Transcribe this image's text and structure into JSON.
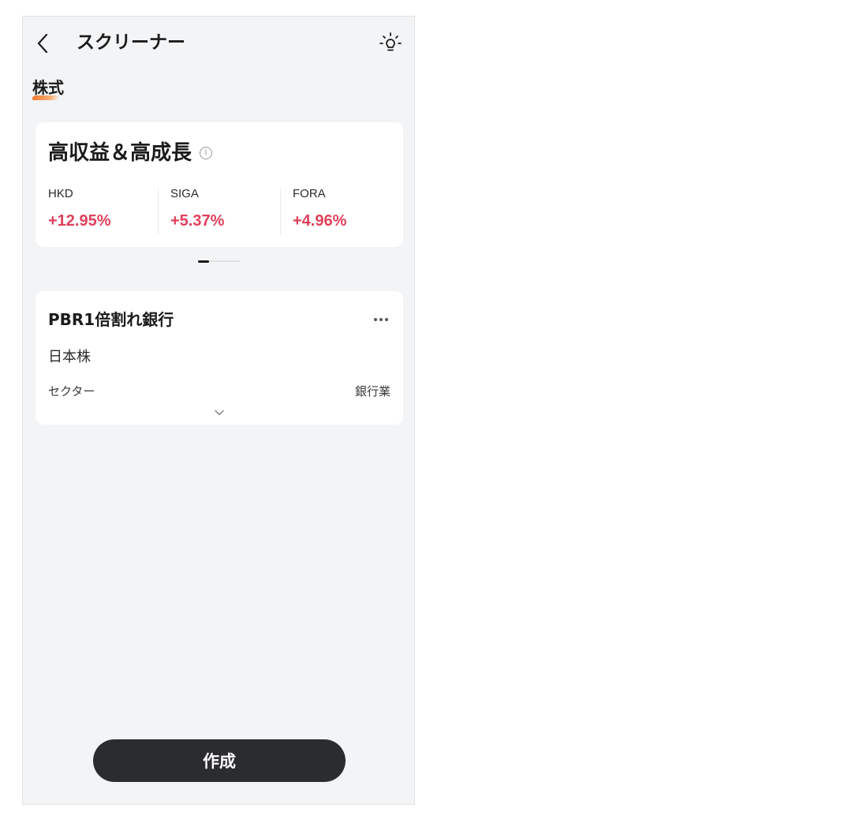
{
  "header": {
    "title": "スクリーナー",
    "back_icon": "chevron-left-icon",
    "tips_icon": "lightbulb-icon"
  },
  "tabs": [
    {
      "label": "株式",
      "active": true
    }
  ],
  "featured": {
    "title": "高収益＆高成長",
    "info_icon": "info-icon",
    "stocks": [
      {
        "symbol": "HKD",
        "change": "+12.95%"
      },
      {
        "symbol": "SIGA",
        "change": "+5.37%"
      },
      {
        "symbol": "FORA",
        "change": "+4.96%"
      }
    ],
    "page": {
      "current": 1
    }
  },
  "screen_card": {
    "title": "PBR1倍割れ銀行",
    "market": "日本株",
    "criteria": [
      {
        "label": "セクター",
        "value": "銀行業"
      }
    ],
    "more_icon": "more-horizontal-icon",
    "expand_icon": "chevron-down-icon"
  },
  "actions": {
    "create_label": "作成"
  },
  "colors": {
    "positive": "#e0405b",
    "button_bg": "#2b2c30",
    "background": "#f3f4f6",
    "tab_accent": "#f27a2e"
  }
}
